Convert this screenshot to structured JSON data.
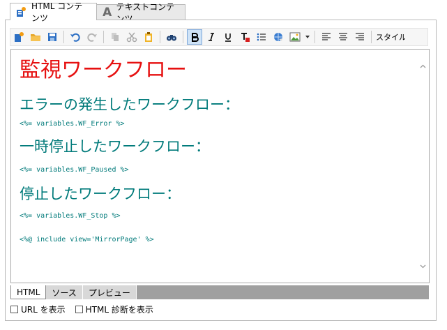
{
  "tabs": [
    {
      "label": "HTML コンテンツ",
      "icon": "html-content-icon",
      "active": true
    },
    {
      "label": "テキストコンテンツ",
      "icon": "text-a-icon",
      "glyph": "A",
      "active": false
    }
  ],
  "toolbar": {
    "style_label": "スタイル"
  },
  "document": {
    "title": "監視ワークフロー",
    "sections": [
      {
        "heading": "エラーの発生したワークフロー：",
        "code": "<%= variables.WF_Error %>"
      },
      {
        "heading": "一時停止したワークフロー：",
        "code": "<%= variables.WF_Paused %>"
      },
      {
        "heading": "停止したワークフロー：",
        "code": "<%= variables.WF_Stop %>"
      }
    ],
    "include": "<%@ include view='MirrorPage' %>"
  },
  "mode_tabs": [
    "HTML",
    "ソース",
    "プレビュー"
  ],
  "options": {
    "show_url": "URL を表示",
    "show_diag": "HTML 診断を表示"
  },
  "colors": {
    "title_red": "#e61010",
    "heading_teal": "#007a7a"
  }
}
